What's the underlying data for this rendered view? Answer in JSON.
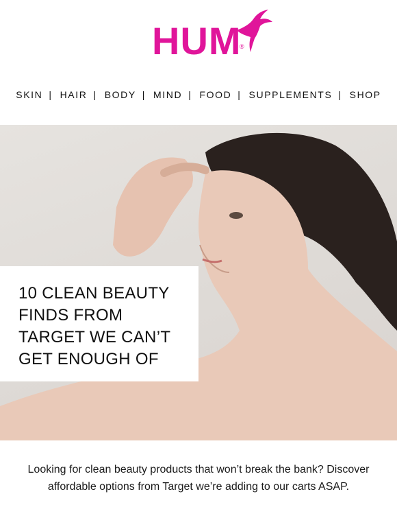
{
  "brand": {
    "logo_text": "HUM",
    "registered": "®",
    "color": "#e0159a"
  },
  "nav": {
    "items": [
      "SKIN",
      "HAIR",
      "BODY",
      "MIND",
      "FOOD",
      "SUPPLEMENTS",
      "SHOP"
    ],
    "separator": "|"
  },
  "hero": {
    "title_lines": [
      "10 CLEAN BEAUTY",
      "FINDS FROM",
      "TARGET WE CAN’T",
      "GET ENOUGH OF"
    ]
  },
  "intro": {
    "text": "Looking for clean beauty products that won’t break the bank? Discover affordable options from Target we’re adding to our carts ASAP."
  }
}
